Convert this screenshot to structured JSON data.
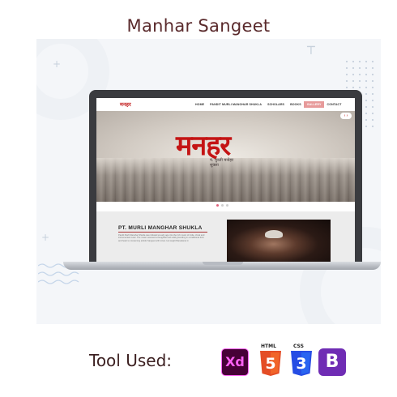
{
  "project": {
    "title": "Manhar Sangeet"
  },
  "site": {
    "logo": "मनहर",
    "nav": [
      "HOME",
      "PANDIT MURLI MANOHAR SHUKLA",
      "SCHOLARS",
      "BOOKS",
      "GALLERY",
      "CONTACT"
    ],
    "active_nav": "GALLERY",
    "hero": {
      "title": "मनहर",
      "subtitle_line1": "पं. मुरली मनोहर",
      "subtitle_line2": "शुक्ला",
      "arrow": "‹ ›"
    },
    "carousel": {
      "slides": 3,
      "active": 1
    },
    "bio": {
      "heading": "PT. MURLI MANGHAR SHUKLA",
      "text": "Pandit Murli Manohar Shukla was initiated at early age into the rich music of India. Vocal and instrumental music. The music received a thoughtful and solid grounding in a traditional form and heart to conserving artistic Sangeet with tones. He taught Banadaras in"
    }
  },
  "tools": {
    "label": "Tool Used:",
    "items": [
      {
        "name": "Adobe XD",
        "mark": "Xd",
        "color": "#ff61f6"
      },
      {
        "name": "HTML5",
        "caption": "HTML",
        "mark": "5",
        "color": "#e44d26"
      },
      {
        "name": "CSS3",
        "caption": "CSS",
        "mark": "3",
        "color": "#264de4"
      },
      {
        "name": "Bootstrap",
        "mark": "B",
        "color": "#6f2cb4"
      }
    ]
  }
}
